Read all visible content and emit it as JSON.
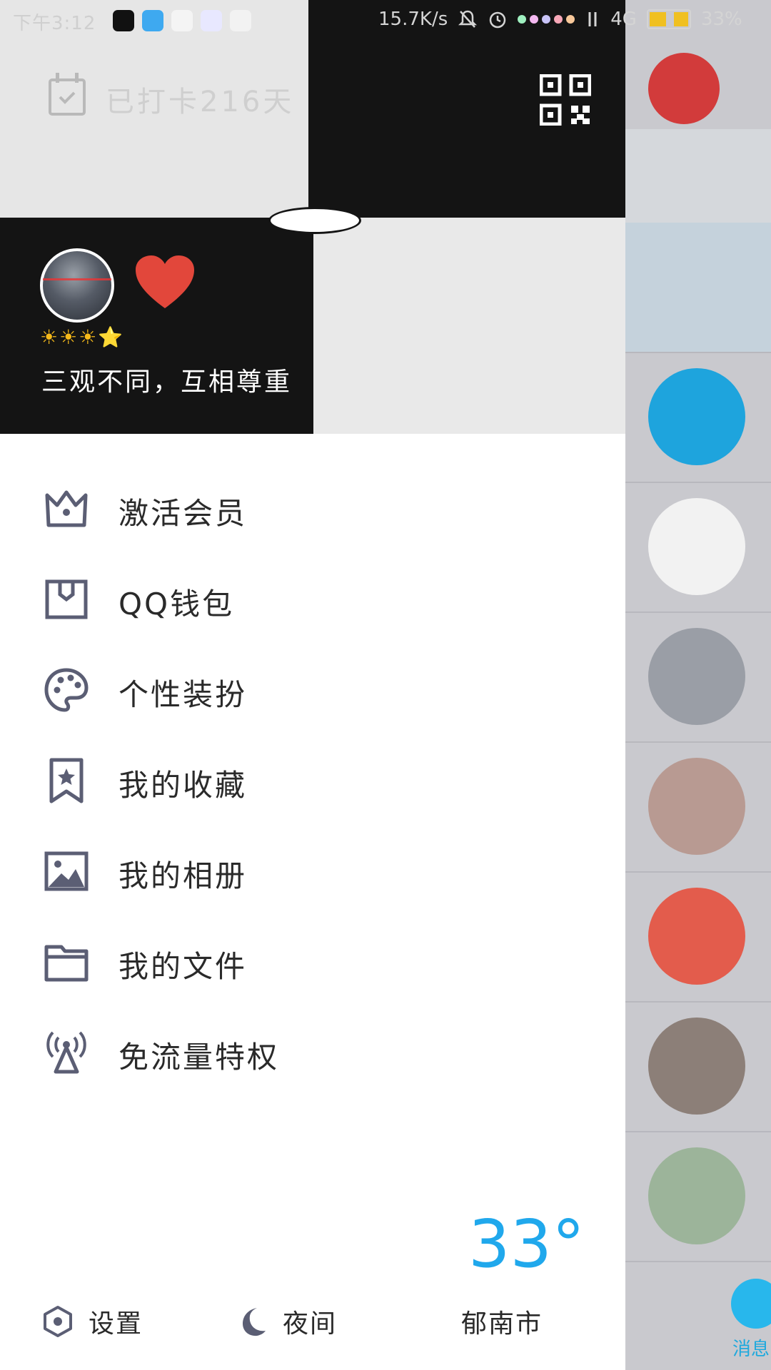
{
  "status_bar": {
    "time": "下午3:12",
    "net_speed": "15.7K/s",
    "network": "4G",
    "battery": "33%",
    "app_icons": [
      "tiktok-icon",
      "weibo-icon",
      "browser-icon",
      "video-icon",
      "game-icon"
    ]
  },
  "header": {
    "checkin_text": "已打卡216天",
    "level_stars": "☀☀☀⭐",
    "signature": "三观不同，互相尊重"
  },
  "menu": {
    "items": [
      {
        "label": "激活会员",
        "icon": "crown-icon"
      },
      {
        "label": "QQ钱包",
        "icon": "wallet-icon"
      },
      {
        "label": "个性装扮",
        "icon": "palette-icon"
      },
      {
        "label": "我的收藏",
        "icon": "bookmark-star-icon"
      },
      {
        "label": "我的相册",
        "icon": "image-icon"
      },
      {
        "label": "我的文件",
        "icon": "folder-icon"
      },
      {
        "label": "免流量特权",
        "icon": "antenna-icon"
      }
    ]
  },
  "weather": {
    "temperature": "33°"
  },
  "footer": {
    "settings_label": "设置",
    "night_label": "夜间",
    "city": "郁南市"
  },
  "background_list": {
    "bottom_tab_label": "消息",
    "avatar_colors": [
      "#d23b3b",
      "#dfe7ef",
      "#1ea4dd",
      "#f4f4f4",
      "#e0e4ea",
      "#c9a9a0",
      "#e35c4c",
      "#aab0b6",
      "#c8d6c0"
    ]
  },
  "colors": {
    "accent_blue": "#20a8ec",
    "header_dark": "#141414",
    "header_light": "#e6e6e6",
    "heart_red": "#e2473b",
    "icon_gray": "#5b5e74"
  }
}
